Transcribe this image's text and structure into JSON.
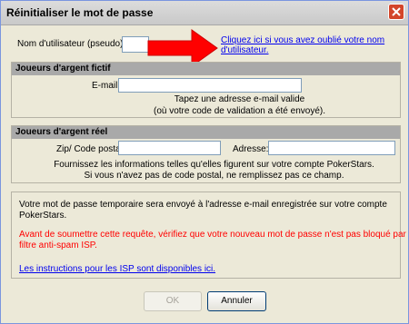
{
  "window": {
    "title": "Réinitialiser le mot de passe"
  },
  "username": {
    "label": "Nom d'utilisateur (pseudo):",
    "value": "",
    "help_link_line1": "Cliquez ici si vous avez oublié votre nom",
    "help_link_line2": "d'utilisateur."
  },
  "fictif": {
    "header": "Joueurs d'argent fictif",
    "email_label": "E-mail:",
    "email_value": "",
    "hint_line1": "Tapez une adresse e-mail valide",
    "hint_line2": "(où votre code de validation a été envoyé)."
  },
  "reel": {
    "header": "Joueurs d'argent réel",
    "zip_label": "Zip/ Code postal:",
    "zip_value": "",
    "address_label": "Adresse:",
    "address_value": "",
    "hint_line1": "Fournissez les informations telles qu'elles figurent sur votre compte PokerStars.",
    "hint_line2": "Si vous n'avez pas de code postal, ne remplissez pas ce champ."
  },
  "info": {
    "line1": "Votre mot de passe temporaire sera envoyé à l'adresse e-mail enregistrée sur votre compte",
    "line2": "PokerStars.",
    "warning_line1": "Avant de soumettre cette requête, vérifiez que votre nouveau mot de passe n'est pas bloqué par un",
    "warning_line2": "filtre anti-spam ISP.",
    "isp_link": "Les instructions pour les ISP sont disponibles ici."
  },
  "buttons": {
    "ok": "OK",
    "cancel": "Annuler"
  },
  "colors": {
    "warning": "#ff0000",
    "link": "#0000ee",
    "arrow": "#ff0000"
  }
}
